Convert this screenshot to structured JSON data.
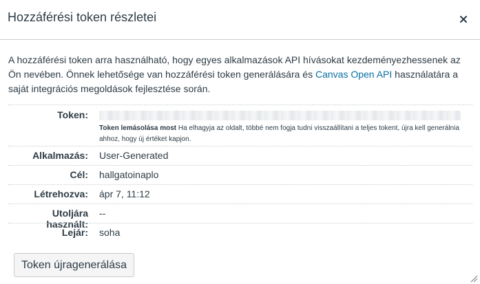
{
  "dialog": {
    "title": "Hozzáférési token részletei",
    "close_glyph": "×"
  },
  "intro": {
    "text_before": "A hozzáférési token arra használható, hogy egyes alkalmazások API hívásokat kezdeményezhessenek az Ön nevében. Önnek lehetősége van hozzáférési token generálására és ",
    "link": "Canvas Open API",
    "text_after": " használatára a saját integrációs megoldások fejlesztése során."
  },
  "details": {
    "token_label": "Token:",
    "token_note_bold": "Token lemásolása most",
    "token_note": " Ha elhagyja az oldalt, többé nem fogja tudni visszaállítani a teljes tokent, újra kell generálnia ahhoz, hogy új értéket kapjon.",
    "rows": [
      {
        "label": "Alkalmazás:",
        "value": "User-Generated"
      },
      {
        "label": "Cél:",
        "value": "hallgatoinaplo"
      },
      {
        "label": "Létrehozva:",
        "value": "ápr 7, 11:12"
      },
      {
        "label": "Utoljára használt:",
        "value": "--"
      },
      {
        "label": "Lejár:",
        "value": "soha"
      }
    ]
  },
  "actions": {
    "regenerate_label": "Token újragenerálása"
  },
  "icons": {
    "close": "close-icon",
    "resize": "resize-grip-icon"
  },
  "colors": {
    "link": "#0770a3",
    "text": "#2d3b45",
    "border": "#c7cdd1"
  }
}
